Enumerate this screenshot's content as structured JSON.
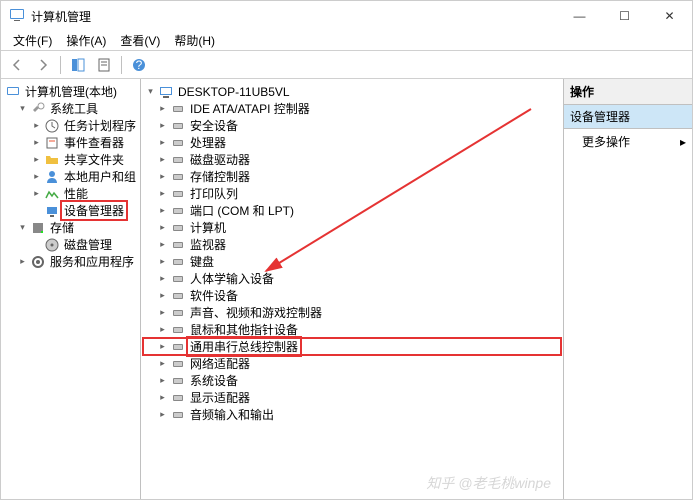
{
  "window": {
    "title": "计算机管理",
    "minimize": "—",
    "maximize": "☐",
    "close": "✕"
  },
  "menubar": {
    "file": "文件(F)",
    "action": "操作(A)",
    "view": "查看(V)",
    "help": "帮助(H)"
  },
  "left_tree": {
    "root": "计算机管理(本地)",
    "system_tools": "系统工具",
    "task_scheduler": "任务计划程序",
    "event_viewer": "事件查看器",
    "shared_folders": "共享文件夹",
    "local_users": "本地用户和组",
    "performance": "性能",
    "device_manager": "设备管理器",
    "storage": "存储",
    "disk_management": "磁盘管理",
    "services_apps": "服务和应用程序"
  },
  "mid_tree": {
    "computer": "DESKTOP-11UB5VL",
    "items": [
      "IDE ATA/ATAPI 控制器",
      "安全设备",
      "处理器",
      "磁盘驱动器",
      "存储控制器",
      "打印队列",
      "端口 (COM 和 LPT)",
      "计算机",
      "监视器",
      "键盘",
      "人体学输入设备",
      "软件设备",
      "声音、视频和游戏控制器",
      "鼠标和其他指针设备",
      "通用串行总线控制器",
      "网络适配器",
      "系统设备",
      "显示适配器",
      "音频输入和输出"
    ],
    "highlight_index": 14
  },
  "actions": {
    "header": "操作",
    "selected": "设备管理器",
    "more": "更多操作",
    "caret": "▸"
  },
  "watermark": "知乎 @老毛桃winpe"
}
